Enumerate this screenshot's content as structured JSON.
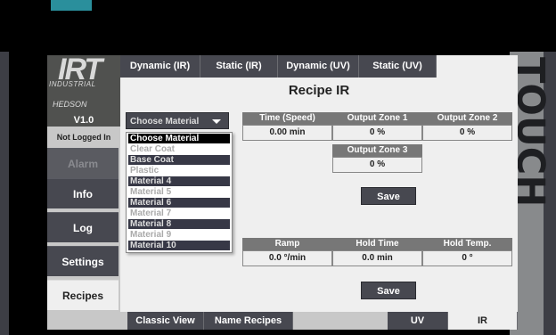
{
  "side": {
    "logo_text": "IRT",
    "logo_sub": "INDUSTRIAL",
    "brand": "HEDSON",
    "version": "V1.0",
    "login_status": "Not Logged In",
    "buttons": [
      "Alarm",
      "Info",
      "Log",
      "Settings",
      "Recipes"
    ]
  },
  "tabs": [
    "Dynamic (IR)",
    "Static (IR)",
    "Dynamic (UV)",
    "Static (UV)"
  ],
  "title": "Recipe IR",
  "dropdown": {
    "selected": "Choose Material",
    "options": [
      "Choose Material",
      "Clear Coat",
      "Base Coat",
      "Plastic",
      "Material 4",
      "Material 5",
      "Material 6",
      "Material 7",
      "Material 8",
      "Material 9",
      "Material 10"
    ]
  },
  "zones": {
    "headers": [
      "Time (Speed)",
      "Output Zone 1",
      "Output Zone 2",
      "Output Zone 3"
    ],
    "values": [
      "0.00 min",
      "0 %",
      "0 %",
      "0 %"
    ]
  },
  "ramp": {
    "headers": [
      "Ramp",
      "Hold Time",
      "Hold Temp."
    ],
    "values": [
      "0.0 °/min",
      "0.0 min",
      "0 °"
    ]
  },
  "save_label": "Save",
  "bottom": [
    "Classic View",
    "Name Recipes",
    "UV",
    "IR"
  ],
  "brand_panel": "TOUCH",
  "colors": {
    "button_dark": "#474850",
    "panel_bg": "#efefef",
    "accent": "#2a8f9c"
  }
}
